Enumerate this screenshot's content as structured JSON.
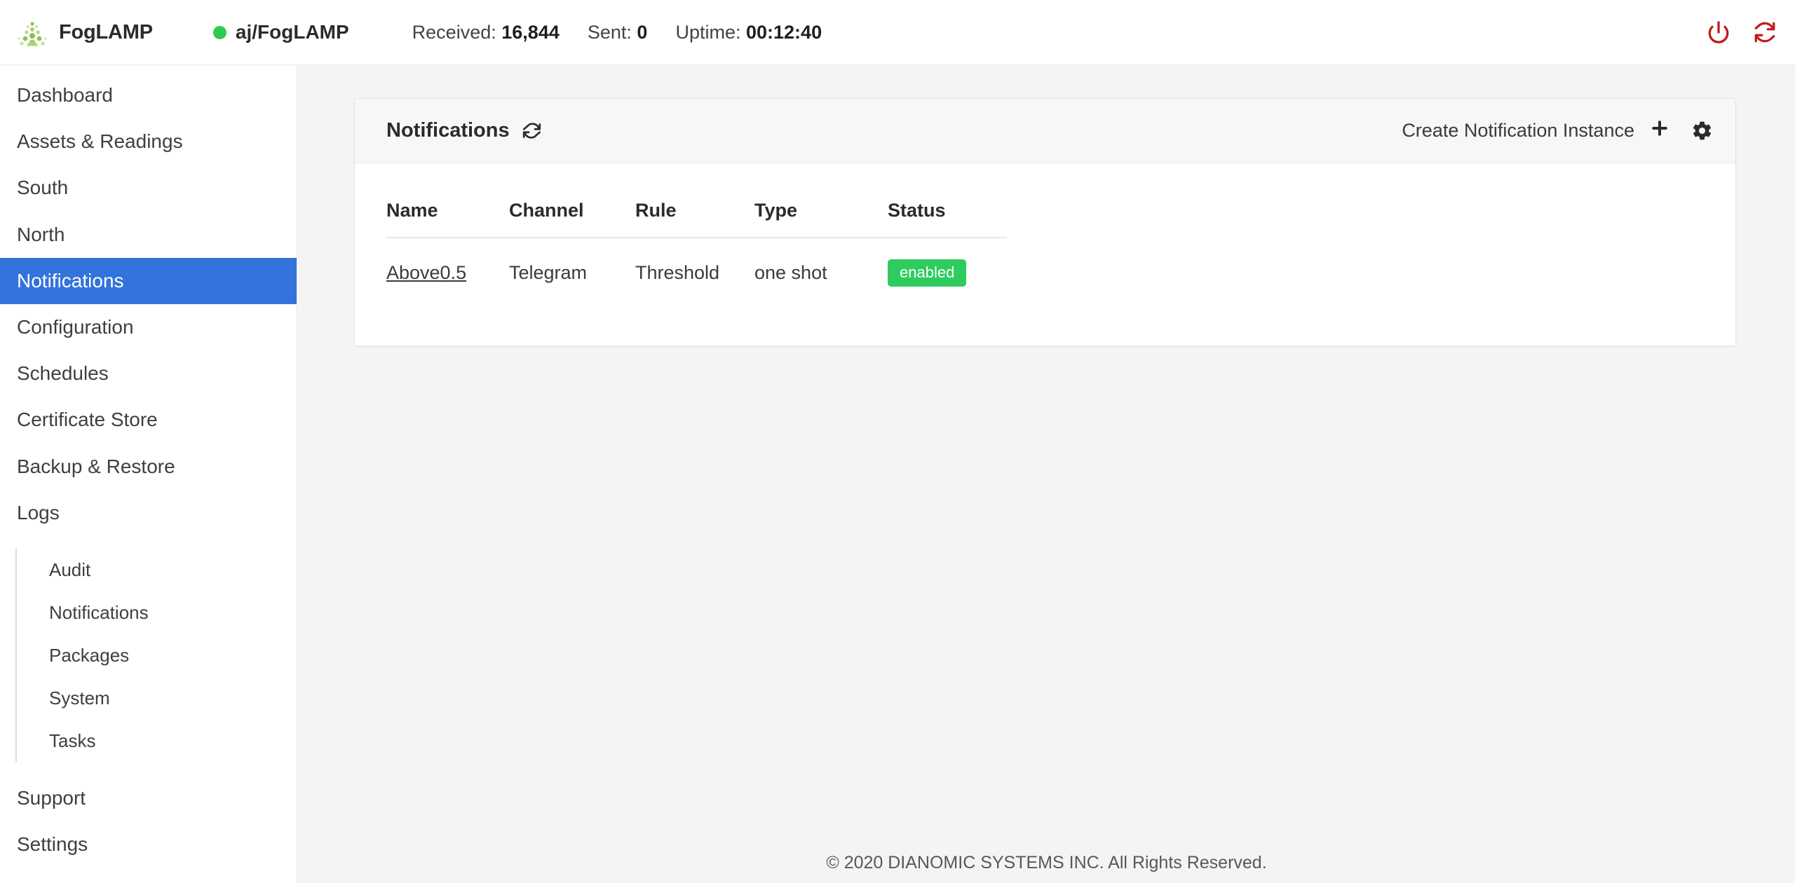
{
  "header": {
    "brand_name": "FogLAMP",
    "logo_icon": "foglamp-dots-logo",
    "instance_name": "aj/FogLAMP",
    "instance_status_icon": "green-status-dot",
    "stats": [
      {
        "label": "Received:",
        "value": "16,844"
      },
      {
        "label": "Sent:",
        "value": "0"
      },
      {
        "label": "Uptime:",
        "value": "00:12:40"
      }
    ],
    "actions": [
      {
        "name": "shutdown-button",
        "icon": "power-icon",
        "color": "#c21a1a"
      },
      {
        "name": "restart-button",
        "icon": "restart-icon",
        "color": "#c21a1a"
      }
    ]
  },
  "sidebar": {
    "items": [
      {
        "label": "Dashboard",
        "active": false
      },
      {
        "label": "Assets & Readings",
        "active": false
      },
      {
        "label": "South",
        "active": false
      },
      {
        "label": "North",
        "active": false
      },
      {
        "label": "Notifications",
        "active": true
      },
      {
        "label": "Configuration",
        "active": false
      },
      {
        "label": "Schedules",
        "active": false
      },
      {
        "label": "Certificate Store",
        "active": false
      },
      {
        "label": "Backup & Restore",
        "active": false
      },
      {
        "label": "Logs",
        "active": false
      }
    ],
    "logs_submenu": [
      {
        "label": "Audit"
      },
      {
        "label": "Notifications"
      },
      {
        "label": "Packages"
      },
      {
        "label": "System"
      },
      {
        "label": "Tasks"
      }
    ],
    "bottom_items": [
      {
        "label": "Support"
      },
      {
        "label": "Settings"
      }
    ],
    "active_color": "#3273dc"
  },
  "card": {
    "title": "Notifications",
    "refresh_icon": "refresh-icon",
    "create_label": "Create Notification Instance",
    "create_icon": "plus-icon",
    "settings_icon": "gear-icon",
    "table": {
      "columns": [
        "Name",
        "Channel",
        "Rule",
        "Type",
        "Status"
      ],
      "rows": [
        {
          "name": "Above0.5",
          "channel": "Telegram",
          "rule": "Threshold",
          "type": "one shot",
          "status": "enabled",
          "status_color": "#2ecc5f"
        }
      ]
    }
  },
  "footer": {
    "copyright": "© 2020 DIANOMIC SYSTEMS INC. All Rights Reserved."
  }
}
